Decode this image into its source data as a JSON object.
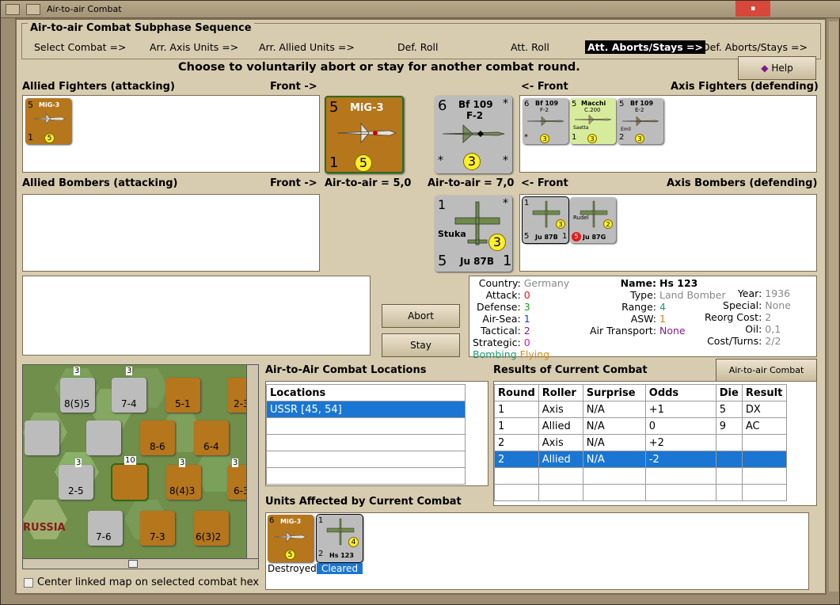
{
  "window": {
    "title": "Air-to-air Combat"
  },
  "subphase": {
    "title": "Air-to-air Combat Subphase Sequence",
    "steps": [
      "Select Combat =>",
      "Arr. Axis Units =>",
      "Arr. Allied Units =>",
      "Def. Roll",
      "Att. Roll",
      "Att. Aborts/Stays =>",
      "Def. Aborts/Stays =>"
    ],
    "active_step": "Att. Aborts/Stays =>"
  },
  "prompt": "Choose to voluntarily abort or stay for another combat round.",
  "help_button": "Help",
  "allied_fighters": {
    "title": "Allied Fighters (attacking)",
    "front": "Front ->",
    "counters": [
      {
        "name": "MiG-3",
        "attack": "5",
        "defense": "1",
        "range": "5"
      }
    ]
  },
  "axis_fighters": {
    "title": "Axis Fighters (defending)",
    "front": "<- Front",
    "counters": [
      {
        "name": "Bf 109",
        "sub": "F-2",
        "attack": "6",
        "defense": "*",
        "range": "3"
      },
      {
        "name": "Macchi",
        "sub": "C.200",
        "extra": "Saetta",
        "attack": "5",
        "defense": "1",
        "range": "3"
      },
      {
        "name": "Bf 109",
        "sub": "E-2",
        "extra": "Emil",
        "attack": "5",
        "defense": "2",
        "range": "3"
      }
    ]
  },
  "allied_bombers": {
    "title": "Allied Bombers (attacking)",
    "front": "Front ->"
  },
  "axis_bombers": {
    "title": "Axis Bombers (defending)",
    "front": "<- Front",
    "counters": [
      {
        "name": "Ju 87B",
        "extra": "Stuka",
        "attack": "1",
        "defense": "5",
        "range": "3",
        "tac": "1"
      },
      {
        "name": "Ju 87G",
        "extra": "Rudel",
        "attack": "1",
        "defense": "5",
        "range": "2",
        "tac": ""
      }
    ]
  },
  "front_allied_fighter": {
    "name": "MiG-3",
    "attack": "5",
    "defense": "1",
    "range": "5",
    "air_to_air": "Air-to-air = 5,0"
  },
  "front_axis_fighter": {
    "name": "Bf 109",
    "sub": "F-2",
    "attack": "6",
    "defense": "*",
    "range": "3",
    "air_to_air": "Air-to-air = 7,0"
  },
  "front_axis_bomber": {
    "name": "Ju 87B",
    "extra": "Stuka",
    "attack": "1",
    "defense": "5",
    "range": "3",
    "tac": "1"
  },
  "buttons": {
    "abort": "Abort",
    "stay": "Stay",
    "chart": "Air-to-air Combat Chart"
  },
  "unit_info": {
    "country_label": "Country:",
    "country": "Germany",
    "attack_label": "Attack:",
    "attack": "0",
    "defense_label": "Defense:",
    "defense": "3",
    "airsea_label": "Air-Sea:",
    "airsea": "1",
    "tactical_label": "Tactical:",
    "tactical": "2",
    "strategic_label": "Strategic:",
    "strategic": "0",
    "bombing": "Bombing",
    "flying": "Flying",
    "name_label": "Name:",
    "name": "Hs 123",
    "type_label": "Type:",
    "type": "Land Bomber",
    "range_label": "Range:",
    "range": "4",
    "asw_label": "ASW:",
    "asw": "1",
    "transport_label": "Air Transport:",
    "transport": "None",
    "year_label": "Year:",
    "year": "1936",
    "special_label": "Special:",
    "special": "None",
    "reorg_label": "Reorg Cost:",
    "reorg": "2",
    "oil_label": "Oil:",
    "oil": "0,1",
    "cost_label": "Cost/Turns:",
    "cost": "2/2"
  },
  "locations": {
    "title": "Air-to-Air Combat Locations",
    "header": "Locations",
    "items": [
      "USSR [45, 54]"
    ]
  },
  "results": {
    "title": "Results of Current Combat",
    "headers": [
      "Round",
      "Roller",
      "Surprise",
      "Odds",
      "Die",
      "Result"
    ],
    "rows": [
      [
        "1",
        "Axis",
        "N/A",
        "+1",
        "5",
        "DX"
      ],
      [
        "1",
        "Allied",
        "N/A",
        "0",
        "9",
        "AC"
      ],
      [
        "2",
        "Axis",
        "N/A",
        "+2",
        "",
        ""
      ],
      [
        "2",
        "Allied",
        "N/A",
        "-2",
        "",
        ""
      ]
    ]
  },
  "affected": {
    "title": "Units Affected by Current Combat",
    "units": [
      {
        "name": "MiG-3",
        "attack": "6",
        "range": "5",
        "status": "Destroyed"
      },
      {
        "name": "Hs 123",
        "attack": "2",
        "defense": "1",
        "range": "4",
        "status": "Cleared"
      }
    ]
  },
  "map": {
    "label": "RUSSIA",
    "center_checkbox": "Center linked map on selected combat hex",
    "units": [
      {
        "n": "8(5)5"
      },
      {
        "n": "7-4"
      },
      {
        "n": "5-1"
      },
      {
        "n": "2-3"
      },
      {
        "n": "8-6"
      },
      {
        "n": "6-4"
      },
      {
        "n": "2-5"
      },
      {
        "n": "8(4)3"
      },
      {
        "n": "6-3"
      },
      {
        "n": "7-6"
      },
      {
        "n": "7-3"
      },
      {
        "n": "6(3)2"
      }
    ],
    "stacks": [
      "3",
      "3",
      "3",
      "10",
      "3",
      "3"
    ]
  }
}
